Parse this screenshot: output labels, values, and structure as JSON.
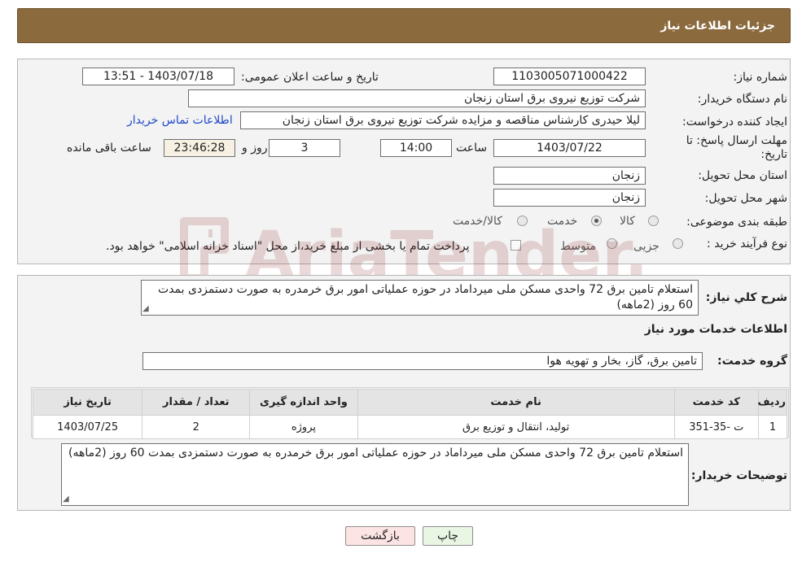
{
  "header": {
    "title": "جزئیات اطلاعات نیاز"
  },
  "form": {
    "need_number": {
      "label": "شماره نیاز:",
      "value": "1103005071000422"
    },
    "announce_datetime": {
      "label": "تاریخ و ساعت اعلان عمومی:",
      "value": "1403/07/18 - 13:51"
    },
    "buyer_org": {
      "label": "نام دستگاه خریدار:",
      "value": "شرکت توزیع نیروی برق استان زنجان"
    },
    "requester": {
      "label": "ایجاد کننده درخواست:",
      "value": "لیلا حیدری کارشناس مناقصه و مزایده شرکت توزیع نیروی برق استان زنجان",
      "contact_link": "اطلاعات تماس خریدار"
    },
    "deadline": {
      "label_line1": "مهلت ارسال پاسخ: تا",
      "label_line2": "تاریخ:",
      "date": "1403/07/22",
      "time_label": "ساعت",
      "time": "14:00",
      "days": "3",
      "days_label": "روز و",
      "remaining": "23:46:28",
      "remaining_label": "ساعت باقی مانده"
    },
    "delivery_province": {
      "label": "استان محل تحویل:",
      "value": "زنجان"
    },
    "delivery_city": {
      "label": "شهر محل تحویل:",
      "value": "زنجان"
    },
    "category": {
      "label": "طبقه بندی موضوعی:",
      "options": [
        "کالا",
        "خدمت",
        "کالا/خدمت"
      ],
      "selected": "خدمت"
    },
    "process_type": {
      "label": "نوع فرآیند خرید :",
      "options": [
        "جزیی",
        "متوسط"
      ],
      "payment_note": "پرداخت تمام یا بخشی از مبلغ خرید،از محل \"اسناد خزانه اسلامی\" خواهد بود."
    }
  },
  "summary": {
    "label": "شرح كلي نياز:",
    "value": "استعلام تامین برق 72 واحدی مسکن ملی میرداماد در حوزه عملیاتی امور برق خرمدره به صورت دستمزدی بمدت  60 روز (2ماهه)"
  },
  "services_section": {
    "title": "اطلاعات خدمات مورد نیاز",
    "service_group_label": "گروه خدمت:",
    "service_group_value": "تامین برق، گاز، بخار و تهویه هوا"
  },
  "table": {
    "columns": [
      "ردیف",
      "کد خدمت",
      "نام خدمت",
      "واحد اندازه گیری",
      "تعداد / مقدار",
      "تاریخ نیاز"
    ],
    "rows": [
      [
        "1",
        "ت -35-351",
        "تولید، انتقال و توزیع برق",
        "پروژه",
        "2",
        "1403/07/25"
      ]
    ]
  },
  "buyer_notes": {
    "label": "توضیحات خریدار:",
    "value": "استعلام تامین برق 72 واحدی مسکن ملی میرداماد در حوزه عملیاتی امور برق خرمدره به صورت دستمزدی بمدت  60 روز (2ماهه)"
  },
  "buttons": {
    "print": "چاپ",
    "back": "بازگشت"
  },
  "watermark": {
    "text": "AriaTender.neT"
  }
}
